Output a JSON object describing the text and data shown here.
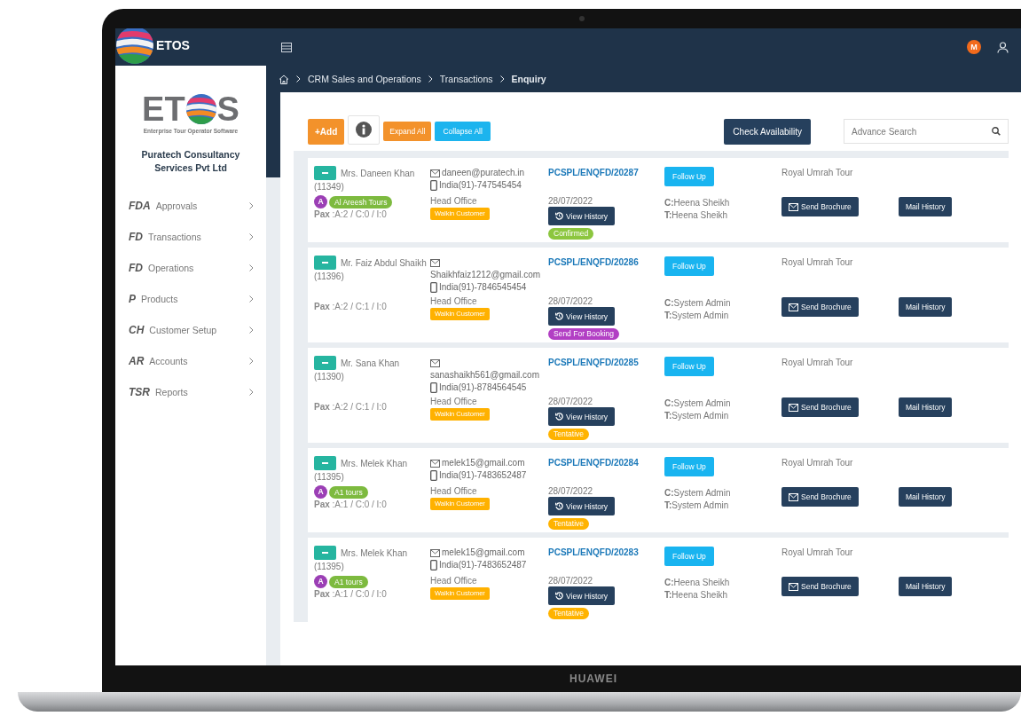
{
  "laptop": {
    "brand": "HUAWEI"
  },
  "topbar": {
    "app_name": "ETOS",
    "user_initial": "M"
  },
  "breadcrumb": [
    "CRM Sales and Operations",
    "Transactions",
    "Enquiry"
  ],
  "sidebar": {
    "logo": {
      "left": "ET",
      "right": "S",
      "tagline": "Enterprise Tour Operator Software"
    },
    "company": "Puratech Consultancy Services Pvt Ltd",
    "items": [
      {
        "code": "FDA",
        "label": "Approvals"
      },
      {
        "code": "FD",
        "label": "Transactions"
      },
      {
        "code": "FD",
        "label": "Operations"
      },
      {
        "code": "P",
        "label": "Products"
      },
      {
        "code": "CH",
        "label": "Customer Setup"
      },
      {
        "code": "AR",
        "label": "Accounts"
      },
      {
        "code": "TSR",
        "label": "Reports"
      }
    ]
  },
  "toolbar": {
    "add": "+Add",
    "expand": "Expand All",
    "collapse": "Collapse All",
    "check": "Check Availability",
    "search": {
      "placeholder": "Advance Search"
    }
  },
  "enquiries": [
    {
      "name": "Mrs. Daneen Khan",
      "id": "(11349)",
      "agent": {
        "initial": "A",
        "name": "Al Areesh Tours"
      },
      "pax": "**Pax** :A:2 / C:0 / I:0",
      "email": "daneen@puratech.in",
      "phone": "India(91)-747545454",
      "branch": "Head Office",
      "customer_type": "Walkin Customer",
      "ref": "PCSPL/ENQFD/20287",
      "date": "28/07/2022",
      "view_history": "View History",
      "status": {
        "label": "Confirmed",
        "color": "#8cc63f"
      },
      "follow_up": "Follow Up",
      "tour": "Royal Umrah Tour",
      "created_by": "**C:**Heena Sheikh",
      "assigned_to": "**T:**Heena Sheikh",
      "send_brochure": "Send Brochure",
      "mail_history": "Mail History"
    },
    {
      "name": "Mr. Faiz Abdul Shaikh",
      "id": "(11396)",
      "pax": "**Pax** :A:2 / C:1 / I:0",
      "email": "Shaikhfaiz1212@gmail.com",
      "phone": "India(91)-7846545454",
      "branch": "Head Office",
      "customer_type": "Walkin Customer",
      "ref": "PCSPL/ENQFD/20286",
      "date": "28/07/2022",
      "view_history": "View History",
      "status": {
        "label": "Send For Booking",
        "color": "#b23fc4"
      },
      "follow_up": "Follow Up",
      "tour": "Royal Umrah Tour",
      "created_by": "**C:**System Admin",
      "assigned_to": "**T:**System Admin",
      "send_brochure": "Send Brochure",
      "mail_history": "Mail History"
    },
    {
      "name": "Mr. Sana Khan",
      "id": "(11390)",
      "pax": "**Pax** :A:2 / C:1 / I:0",
      "email": "sanashaikh561@gmail.com",
      "phone": "India(91)-8784564545",
      "branch": "Head Office",
      "customer_type": "Walkin Customer",
      "ref": "PCSPL/ENQFD/20285",
      "date": "28/07/2022",
      "view_history": "View History",
      "status": {
        "label": "Tentative",
        "color": "#ffb300"
      },
      "follow_up": "Follow Up",
      "tour": "Royal Umrah Tour",
      "created_by": "**C:**System Admin",
      "assigned_to": "**T:**System Admin",
      "send_brochure": "Send Brochure",
      "mail_history": "Mail History"
    },
    {
      "name": "Mrs. Melek Khan",
      "id": "(11395)",
      "agent": {
        "initial": "A",
        "name": "A1 tours"
      },
      "pax": "**Pax** :A:1 / C:0 / I:0",
      "email": "melek15@gmail.com",
      "phone": "India(91)-7483652487",
      "branch": "Head Office",
      "customer_type": "Walkin Customer",
      "ref": "PCSPL/ENQFD/20284",
      "date": "28/07/2022",
      "view_history": "View History",
      "status": {
        "label": "Tentative",
        "color": "#ffb300"
      },
      "follow_up": "Follow Up",
      "tour": "Royal Umrah Tour",
      "created_by": "**C:**System Admin",
      "assigned_to": "**T:**System Admin",
      "send_brochure": "Send Brochure",
      "mail_history": "Mail History"
    },
    {
      "name": "Mrs. Melek Khan",
      "id": "(11395)",
      "agent": {
        "initial": "A",
        "name": "A1 tours"
      },
      "pax": "**Pax** :A:1 / C:0 / I:0",
      "email": "melek15@gmail.com",
      "phone": "India(91)-7483652487",
      "branch": "Head Office",
      "customer_type": "Walkin Customer",
      "ref": "PCSPL/ENQFD/20283",
      "date": "28/07/2022",
      "view_history": "View History",
      "status": {
        "label": "Tentative",
        "color": "#ffb300"
      },
      "follow_up": "Follow Up",
      "tour": "Royal Umrah Tour",
      "created_by": "**C:**Heena Sheikh",
      "assigned_to": "**T:**Heena Sheikh",
      "send_brochure": "Send Brochure",
      "mail_history": "Mail History"
    }
  ]
}
